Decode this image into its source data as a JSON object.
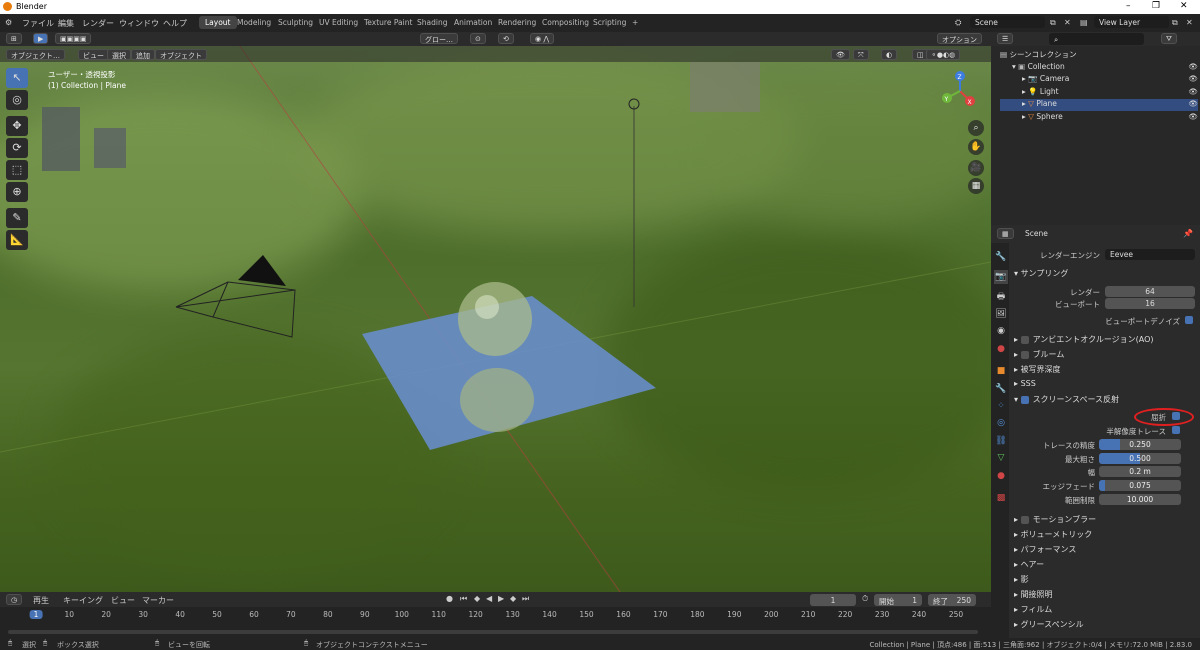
{
  "window": {
    "title": "Blender",
    "controls": [
      "–",
      "❐",
      "✕"
    ]
  },
  "menus": [
    "ファイル",
    "編集",
    "レンダー",
    "ウィンドウ",
    "ヘルプ"
  ],
  "workspaces": [
    "Layout",
    "Modeling",
    "Sculpting",
    "UV Editing",
    "Texture Paint",
    "Shading",
    "Animation",
    "Rendering",
    "Compositing",
    "Scripting",
    "+"
  ],
  "scene": {
    "name": "Scene",
    "view_layer": "View Layer"
  },
  "viewport": {
    "mode": "オブジェクト…",
    "menu": [
      "ビュー",
      "選択",
      "追加",
      "オブジェクト"
    ],
    "orientation": "グロー…",
    "options": "オプション",
    "overlay_line1": "ユーザー・透視投影",
    "overlay_line2": "(1) Collection | Plane",
    "gizmo_axes": {
      "x": "X",
      "y": "Y",
      "z": "Z"
    }
  },
  "outliner": {
    "title": "シーンコレクション",
    "rows": [
      {
        "label": "Collection",
        "indent": 1,
        "color": "#b5b5b5"
      },
      {
        "label": "Camera",
        "indent": 2,
        "color": "#e98b45"
      },
      {
        "label": "Light",
        "indent": 2,
        "color": "#e98b45"
      },
      {
        "label": "Plane",
        "indent": 2,
        "color": "#e98b45"
      },
      {
        "label": "Sphere",
        "indent": 2,
        "color": "#e98b45"
      }
    ]
  },
  "properties": {
    "context": "Scene",
    "render_engine_label": "レンダーエンジン",
    "render_engine": "Eevee",
    "sampling": {
      "title": "サンプリング",
      "render_label": "レンダー",
      "render": "64",
      "viewport_label": "ビューポート",
      "viewport": "16",
      "denoise_label": "ビューポートデノイズ"
    },
    "sections": [
      {
        "label": "アンビエントオクルージョン(AO)",
        "checkbox": true,
        "checked": false
      },
      {
        "label": "ブルーム",
        "checkbox": true,
        "checked": false
      },
      {
        "label": "被写界深度",
        "checkbox": false
      },
      {
        "label": "SSS",
        "checkbox": false
      }
    ],
    "ssr": {
      "title": "スクリーンスペース反射",
      "refraction_label": "屈折",
      "half_res_label": "半解像度トレース",
      "fields": [
        {
          "label": "トレースの精度",
          "value": "0.250",
          "fill": 0.25
        },
        {
          "label": "最大粗さ",
          "value": "0.500",
          "fill": 0.5
        },
        {
          "label": "幅",
          "value": "0.2 m",
          "fill": 0
        },
        {
          "label": "エッジフェード",
          "value": "0.075",
          "fill": 0.075
        },
        {
          "label": "範囲制限",
          "value": "10.000",
          "fill": 0
        }
      ]
    },
    "after_sections": [
      "モーションブラー",
      "ボリューメトリック",
      "パフォーマンス",
      "ヘアー",
      "影",
      "間接照明",
      "フィルム",
      "グリースペンシル"
    ],
    "motion_blur_checkbox": true
  },
  "timeline": {
    "menu": [
      "再生",
      "キーイング",
      "ビュー",
      "マーカー"
    ],
    "current_frame": "1",
    "start_label": "開始",
    "start": "1",
    "end_label": "終了",
    "end": "250",
    "ticks": [
      "1",
      "10",
      "20",
      "30",
      "40",
      "50",
      "60",
      "70",
      "80",
      "90",
      "100",
      "110",
      "120",
      "130",
      "140",
      "150",
      "160",
      "170",
      "180",
      "190",
      "200",
      "210",
      "220",
      "230",
      "240",
      "250"
    ]
  },
  "status": {
    "select": "選択",
    "box_select": "ボックス選択",
    "rotate_view": "ビューを回転",
    "context_menu": "オブジェクトコンテクストメニュー",
    "stats": "Collection | Plane | 頂点:486 | 面:513 | 三角面:962 | オブジェクト:0/4 | メモリ:72.0 MiB | 2.83.0"
  }
}
